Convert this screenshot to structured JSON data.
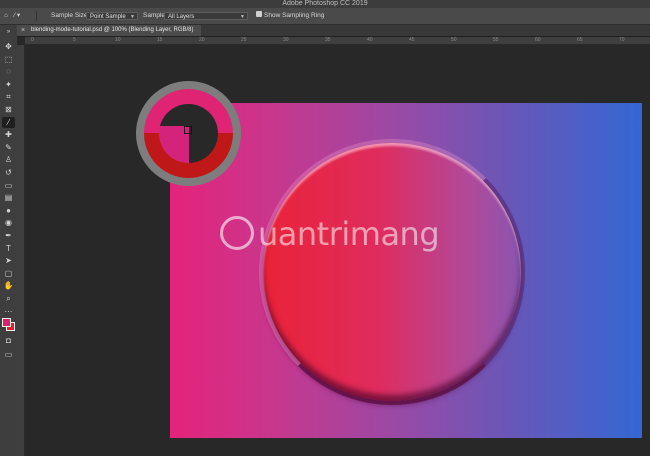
{
  "app": {
    "title": "Adobe Photoshop CC 2019"
  },
  "options_bar": {
    "sample_size_label": "Sample Size:",
    "sample_size_value": "Point Sample",
    "sample_label": "Sample:",
    "sample_value": "All Layers",
    "show_sampling_ring_label": "Show Sampling Ring",
    "show_sampling_ring_checked": true
  },
  "document": {
    "tab_label": "blending-mode-tutorial.psd @ 100% (Blending Layer, RGB/8)",
    "close_glyph": "×"
  },
  "ruler": {
    "ticks": [
      "0",
      "5",
      "10",
      "15",
      "20",
      "25",
      "30",
      "35",
      "40",
      "45",
      "50",
      "55",
      "60",
      "65",
      "70"
    ]
  },
  "tools": [
    {
      "icon": "move-icon",
      "glyph": "✥"
    },
    {
      "icon": "marquee-icon",
      "glyph": "⬚"
    },
    {
      "icon": "lasso-icon",
      "glyph": "◌"
    },
    {
      "icon": "magic-wand-icon",
      "glyph": "✦"
    },
    {
      "icon": "crop-icon",
      "glyph": "⌗"
    },
    {
      "icon": "frame-icon",
      "glyph": "⊠"
    },
    {
      "icon": "eyedropper-icon",
      "glyph": "⁄",
      "active": true
    },
    {
      "icon": "healing-brush-icon",
      "glyph": "✚"
    },
    {
      "icon": "brush-icon",
      "glyph": "✎"
    },
    {
      "icon": "clone-stamp-icon",
      "glyph": "♙"
    },
    {
      "icon": "history-brush-icon",
      "glyph": "↺"
    },
    {
      "icon": "eraser-icon",
      "glyph": "▭"
    },
    {
      "icon": "gradient-icon",
      "glyph": "▤"
    },
    {
      "icon": "blur-icon",
      "glyph": "●"
    },
    {
      "icon": "dodge-icon",
      "glyph": "◉"
    },
    {
      "icon": "pen-icon",
      "glyph": "✒"
    },
    {
      "icon": "type-icon",
      "glyph": "T"
    },
    {
      "icon": "path-selection-icon",
      "glyph": "➤"
    },
    {
      "icon": "rectangle-icon",
      "glyph": "▢"
    },
    {
      "icon": "hand-icon",
      "glyph": "✋"
    },
    {
      "icon": "zoom-icon",
      "glyph": "⌕"
    },
    {
      "icon": "more-icon",
      "glyph": "⋯"
    }
  ],
  "colors": {
    "foreground": "#d6236a",
    "background": "#e02030"
  },
  "watermark": {
    "text": "uantrimang"
  }
}
